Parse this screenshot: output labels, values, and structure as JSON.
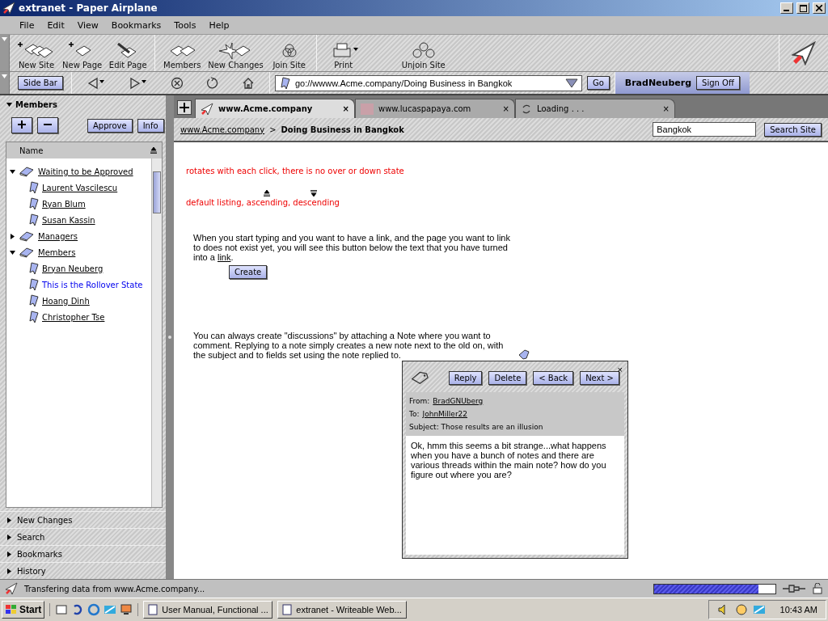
{
  "window": {
    "title": "extranet - Paper Airplane"
  },
  "menu": [
    "File",
    "Edit",
    "View",
    "Bookmarks",
    "Tools",
    "Help"
  ],
  "toolbar": [
    {
      "kind": "new-site",
      "label": "New Site"
    },
    {
      "kind": "new-page",
      "label": "New Page"
    },
    {
      "kind": "edit-page",
      "label": "Edit Page"
    },
    {
      "kind": "members",
      "label": "Members"
    },
    {
      "kind": "new-changes",
      "label": "New Changes"
    },
    {
      "kind": "join-site",
      "label": "Join Site"
    },
    {
      "kind": "print",
      "label": "Print"
    },
    {
      "kind": "unjoin-site",
      "label": "Unjoin Site"
    }
  ],
  "navbar": {
    "sidebar_button": "Side Bar",
    "address": "go://wwww.Acme.company/Doing Business in Bangkok",
    "go_button": "Go",
    "user": "BradNeuberg",
    "sign_off": "Sign Off"
  },
  "tabs": [
    {
      "kind": "site",
      "label": "www.Acme.company",
      "close": "×",
      "selected": true
    },
    {
      "kind": "photo",
      "label": "www.lucaspapaya.com",
      "close": "×",
      "selected": false
    },
    {
      "kind": "loading",
      "label": "Loading . . .",
      "close": "×",
      "selected": false
    }
  ],
  "breadcrumb": {
    "link": "www.Acme.company",
    "separator": ">",
    "current": "Doing Business in Bangkok"
  },
  "site_search": {
    "value": "Bangkok",
    "button": "Search Site"
  },
  "sidebar": {
    "title": "Members",
    "buttons": [
      "Approve",
      "Info"
    ],
    "column": "Name",
    "tree": [
      {
        "label": "Waiting to be Approved",
        "expanded": true,
        "children": [
          {
            "label": "Laurent Vascilescu",
            "hovered": false
          },
          {
            "label": "Ryan Blum",
            "hovered": false
          },
          {
            "label": "Susan Kassin",
            "hovered": false
          }
        ]
      },
      {
        "label": "Managers",
        "expanded": false
      },
      {
        "label": "Members",
        "expanded": true,
        "children": [
          {
            "label": "Bryan Neuberg",
            "hovered": false
          },
          {
            "label": "This is the Rollover State",
            "hovered": true
          },
          {
            "label": "Hoang Dinh",
            "hovered": false
          },
          {
            "label": "Christopher Tse",
            "hovered": false
          }
        ]
      }
    ],
    "panels": [
      "New Changes",
      "Search",
      "Bookmarks",
      "History"
    ]
  },
  "page": {
    "annotation_1": "rotates with each click, there is no over or down state",
    "annotation_2": "default listing, ascending, descending",
    "paragraph_1": {
      "before": "When you start typing and you want to have a link, and the page you want to link to does not exist yet, you will see this button below the text that you have turned into a ",
      "link": "link",
      "after": "."
    },
    "create_button": "Create",
    "paragraph_2": "You can always create \"discussions\" by attaching a Note where you want to comment. Replying to a note simply creates a new note next to the old on, with the subject and to fields set using the note replied to."
  },
  "note": {
    "buttons": [
      "Reply",
      "Delete",
      "< Back",
      "Next >"
    ],
    "close": "×",
    "from_label": "From:",
    "from": "BradGNUberg",
    "to_label": "To:",
    "to": "JohnMiller22",
    "subject": "Subject: Those results are an illusion",
    "body": "Ok, hmm this seems a bit strange...what happens when you have a bunch of notes and there are various threads within the main note? how do you figure out where you are?"
  },
  "status_bar": {
    "text": "Transfering data from www.Acme.company...",
    "level": 0.86
  },
  "taskbar": {
    "start": "Start",
    "tasks": [
      "User Manual, Functional ...",
      "extranet - Writeable Web..."
    ],
    "clock": "10:43 AM"
  }
}
